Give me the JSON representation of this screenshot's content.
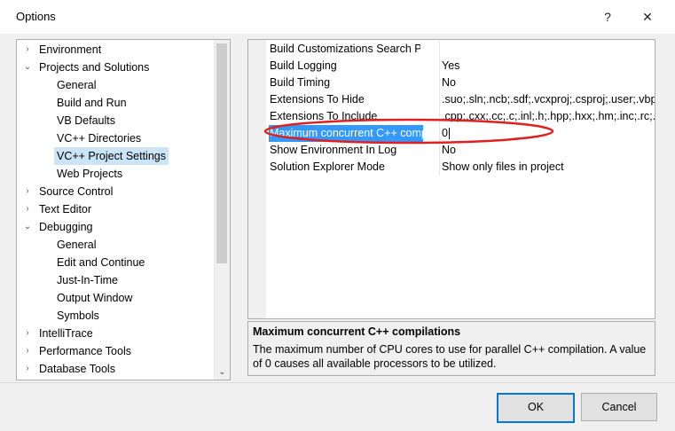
{
  "window": {
    "title": "Options",
    "help_glyph": "?",
    "close_glyph": "✕"
  },
  "tree": {
    "items": [
      {
        "label": "Environment",
        "level": 0,
        "expander": "›"
      },
      {
        "label": "Projects and Solutions",
        "level": 0,
        "expander": "⌄"
      },
      {
        "label": "General",
        "level": 1,
        "expander": ""
      },
      {
        "label": "Build and Run",
        "level": 1,
        "expander": ""
      },
      {
        "label": "VB Defaults",
        "level": 1,
        "expander": ""
      },
      {
        "label": "VC++ Directories",
        "level": 1,
        "expander": ""
      },
      {
        "label": "VC++ Project Settings",
        "level": 1,
        "expander": "",
        "selected": true
      },
      {
        "label": "Web Projects",
        "level": 1,
        "expander": ""
      },
      {
        "label": "Source Control",
        "level": 0,
        "expander": "›"
      },
      {
        "label": "Text Editor",
        "level": 0,
        "expander": "›"
      },
      {
        "label": "Debugging",
        "level": 0,
        "expander": "⌄"
      },
      {
        "label": "General",
        "level": 1,
        "expander": ""
      },
      {
        "label": "Edit and Continue",
        "level": 1,
        "expander": ""
      },
      {
        "label": "Just-In-Time",
        "level": 1,
        "expander": ""
      },
      {
        "label": "Output Window",
        "level": 1,
        "expander": ""
      },
      {
        "label": "Symbols",
        "level": 1,
        "expander": ""
      },
      {
        "label": "IntelliTrace",
        "level": 0,
        "expander": "›"
      },
      {
        "label": "Performance Tools",
        "level": 0,
        "expander": "›"
      },
      {
        "label": "Database Tools",
        "level": 0,
        "expander": "›"
      }
    ],
    "scroll_down_glyph": "⌄"
  },
  "properties": [
    {
      "name": "Build Customizations Search Path",
      "value": ""
    },
    {
      "name": "Build Logging",
      "value": "Yes"
    },
    {
      "name": "Build Timing",
      "value": "No"
    },
    {
      "name": "Extensions To Hide",
      "value": ".suo;.sln;.ncb;.sdf;.vcxproj;.csproj;.user;.vbproj"
    },
    {
      "name": "Extensions To Include",
      "value": ".cpp;.cxx;.cc;.c;.inl;.h;.hpp;.hxx;.hm;.inc;.rc;.resx"
    },
    {
      "name": "Maximum concurrent C++ compilations",
      "value": "0",
      "selected": true
    },
    {
      "name": "Show Environment In Log",
      "value": "No"
    },
    {
      "name": "Solution Explorer Mode",
      "value": "Show only files in project"
    }
  ],
  "description": {
    "title": "Maximum concurrent C++ compilations",
    "text": "The maximum number of CPU cores to use for parallel C++ compilation.  A value of 0 causes all available processors to be utilized."
  },
  "buttons": {
    "ok": "OK",
    "cancel": "Cancel"
  },
  "annotation": {
    "color": "#e02020"
  }
}
